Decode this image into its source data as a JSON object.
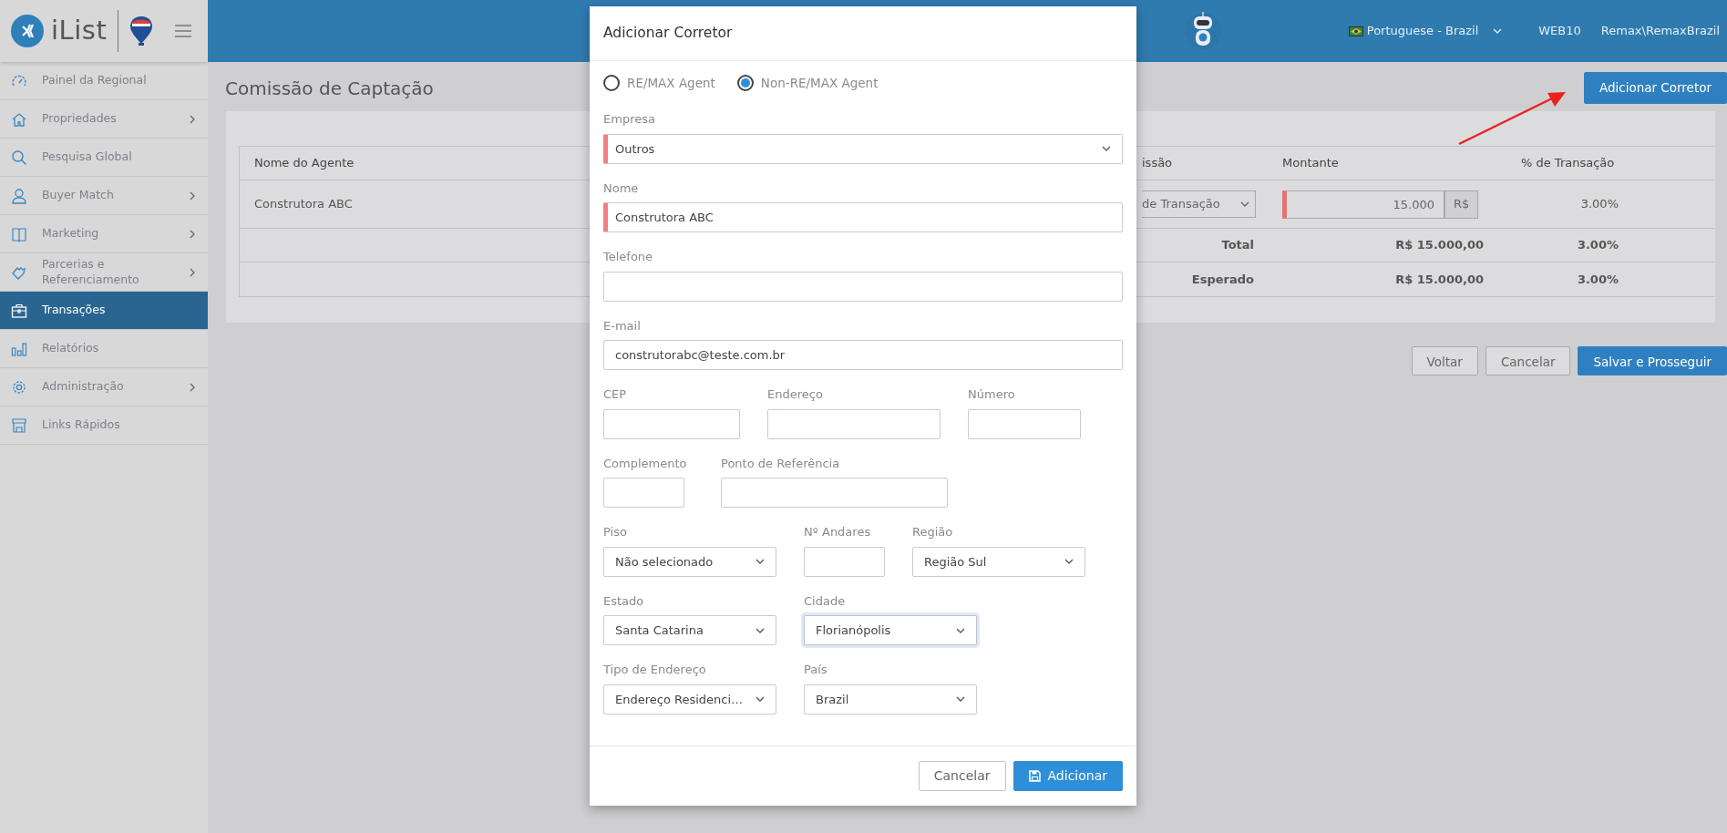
{
  "brand": {
    "logo_text": "iList"
  },
  "sidebar": {
    "items": [
      {
        "label": "Painel da Regional",
        "expandable": false,
        "selected": false
      },
      {
        "label": "Propriedades",
        "expandable": true,
        "selected": false
      },
      {
        "label": "Pesquisa Global",
        "expandable": false,
        "selected": false
      },
      {
        "label": "Buyer Match",
        "expandable": true,
        "selected": false
      },
      {
        "label": "Marketing",
        "expandable": true,
        "selected": false
      },
      {
        "label": "Parcerias e Referenciamento",
        "expandable": true,
        "selected": false
      },
      {
        "label": "Transações",
        "expandable": false,
        "selected": true
      },
      {
        "label": "Relatórios",
        "expandable": false,
        "selected": false
      },
      {
        "label": "Administração",
        "expandable": true,
        "selected": false
      },
      {
        "label": "Links Rápidos",
        "expandable": false,
        "selected": false
      }
    ]
  },
  "header": {
    "language": "Portuguese - Brazil",
    "office": "WEB10",
    "user": "Remax\\RemaxBrazil"
  },
  "page": {
    "title": "Comissão de Captação",
    "add_button": "Adicionar Corretor"
  },
  "table": {
    "columns": [
      "Nome do Agente",
      "issão",
      "Montante",
      "% de Transação"
    ],
    "rows": [
      {
        "agent": "Construtora ABC",
        "type": "de Transação",
        "amount": "15.000",
        "amount_required": true,
        "currency": "R$",
        "percent": "3.00%"
      }
    ],
    "totals": [
      {
        "label": "Total",
        "amount": "R$ 15.000,00",
        "percent": "3.00%"
      },
      {
        "label": "Esperado",
        "amount": "R$ 15.000,00",
        "percent": "3.00%"
      }
    ]
  },
  "actions": [
    {
      "label": "Voltar",
      "kind": "secondary"
    },
    {
      "label": "Cancelar",
      "kind": "secondary"
    },
    {
      "label": "Salvar e Prosseguir",
      "kind": "primary"
    }
  ],
  "modal": {
    "title": "Adicionar Corretor",
    "agent_types": [
      {
        "label": "RE/MAX Agent",
        "selected": false
      },
      {
        "label": "Non-RE/MAX Agent",
        "selected": true
      }
    ],
    "rows": [
      [
        {
          "label": "Empresa",
          "kind": "select",
          "value": "Outros",
          "required": true,
          "focused": false
        }
      ],
      [
        {
          "label": "Nome",
          "kind": "input",
          "value": "Construtora ABC",
          "required": true,
          "focused": false
        }
      ],
      [
        {
          "label": "Telefone",
          "kind": "input",
          "required": false,
          "focused": false
        }
      ],
      [
        {
          "label": "E-mail",
          "kind": "input",
          "value": "construtorabc@teste.com.br",
          "required": false,
          "focused": false
        }
      ],
      [
        {
          "label": "CEP",
          "kind": "input",
          "required": false,
          "focused": false
        },
        {
          "label": "Endereço",
          "kind": "input",
          "required": false,
          "focused": false
        },
        {
          "label": "Número",
          "kind": "input",
          "required": false,
          "focused": false
        }
      ],
      [
        {
          "label": "Complemento",
          "kind": "input",
          "required": false,
          "focused": false
        },
        {
          "label": "Ponto de Referência",
          "kind": "input",
          "required": false,
          "focused": false
        }
      ],
      [
        {
          "label": "Piso",
          "kind": "select",
          "value": "Não selecionado",
          "required": false,
          "focused": false
        },
        {
          "label": "Nº Andares",
          "kind": "input",
          "required": false,
          "focused": false
        },
        {
          "label": "Região",
          "kind": "select",
          "value": "Região Sul",
          "required": false,
          "focused": false
        }
      ],
      [
        {
          "label": "Estado",
          "kind": "select",
          "value": "Santa Catarina",
          "required": false,
          "focused": false
        },
        {
          "label": "Cidade",
          "kind": "select",
          "value": "Florianópolis",
          "required": false,
          "focused": true
        }
      ],
      [
        {
          "label": "Tipo de Endereço",
          "kind": "select",
          "value": "Endereço Residenci…",
          "required": false,
          "focused": false
        },
        {
          "label": "País",
          "kind": "select",
          "value": "Brazil",
          "required": false,
          "focused": false
        }
      ]
    ],
    "buttons": [
      {
        "label": "Cancelar",
        "kind": "secondary"
      },
      {
        "label": "Adicionar",
        "kind": "primary"
      }
    ]
  }
}
